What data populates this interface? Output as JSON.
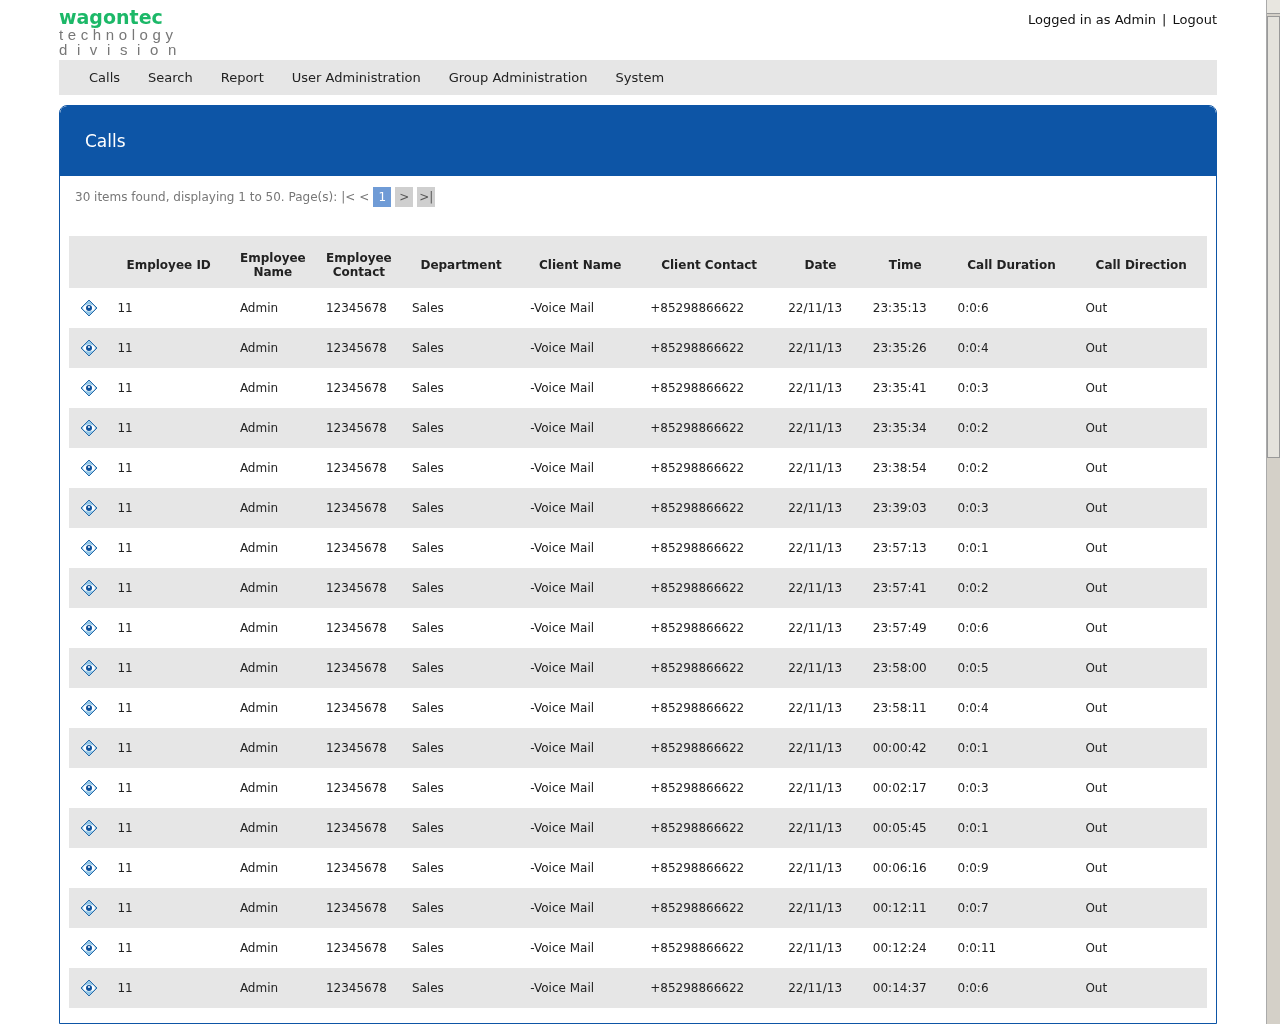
{
  "logo": {
    "brand": "wagontec",
    "line1": "technology",
    "line2": "division"
  },
  "user_bar": {
    "status": "Logged in as Admin",
    "separator": "|",
    "logout": "Logout"
  },
  "nav": [
    "Calls",
    "Search",
    "Report",
    "User Administration",
    "Group Administration",
    "System"
  ],
  "panel": {
    "title": "Calls",
    "pager": {
      "summary": "30 items found, displaying 1 to 50. Page(s):",
      "first": "|<",
      "prev": "<",
      "pages": [
        {
          "label": "1",
          "selected": true
        }
      ],
      "next": ">",
      "last": ">|"
    },
    "table": {
      "columns": [
        "",
        "Employee ID",
        "Employee Name",
        "Employee Contact",
        "Department",
        "Client Name",
        "Client Contact",
        "Date",
        "Time",
        "Call Duration",
        "Call Direction"
      ],
      "rows": [
        [
          "",
          "11",
          "Admin",
          "12345678",
          "Sales",
          "-Voice Mail",
          "+85298866622",
          "22/11/13",
          "23:35:13",
          "0:0:6",
          "Out"
        ],
        [
          "",
          "11",
          "Admin",
          "12345678",
          "Sales",
          "-Voice Mail",
          "+85298866622",
          "22/11/13",
          "23:35:26",
          "0:0:4",
          "Out"
        ],
        [
          "",
          "11",
          "Admin",
          "12345678",
          "Sales",
          "-Voice Mail",
          "+85298866622",
          "22/11/13",
          "23:35:41",
          "0:0:3",
          "Out"
        ],
        [
          "",
          "11",
          "Admin",
          "12345678",
          "Sales",
          "-Voice Mail",
          "+85298866622",
          "22/11/13",
          "23:35:34",
          "0:0:2",
          "Out"
        ],
        [
          "",
          "11",
          "Admin",
          "12345678",
          "Sales",
          "-Voice Mail",
          "+85298866622",
          "22/11/13",
          "23:38:54",
          "0:0:2",
          "Out"
        ],
        [
          "",
          "11",
          "Admin",
          "12345678",
          "Sales",
          "-Voice Mail",
          "+85298866622",
          "22/11/13",
          "23:39:03",
          "0:0:3",
          "Out"
        ],
        [
          "",
          "11",
          "Admin",
          "12345678",
          "Sales",
          "-Voice Mail",
          "+85298866622",
          "22/11/13",
          "23:57:13",
          "0:0:1",
          "Out"
        ],
        [
          "",
          "11",
          "Admin",
          "12345678",
          "Sales",
          "-Voice Mail",
          "+85298866622",
          "22/11/13",
          "23:57:41",
          "0:0:2",
          "Out"
        ],
        [
          "",
          "11",
          "Admin",
          "12345678",
          "Sales",
          "-Voice Mail",
          "+85298866622",
          "22/11/13",
          "23:57:49",
          "0:0:6",
          "Out"
        ],
        [
          "",
          "11",
          "Admin",
          "12345678",
          "Sales",
          "-Voice Mail",
          "+85298866622",
          "22/11/13",
          "23:58:00",
          "0:0:5",
          "Out"
        ],
        [
          "",
          "11",
          "Admin",
          "12345678",
          "Sales",
          "-Voice Mail",
          "+85298866622",
          "22/11/13",
          "23:58:11",
          "0:0:4",
          "Out"
        ],
        [
          "",
          "11",
          "Admin",
          "12345678",
          "Sales",
          "-Voice Mail",
          "+85298866622",
          "22/11/13",
          "00:00:42",
          "0:0:1",
          "Out"
        ],
        [
          "",
          "11",
          "Admin",
          "12345678",
          "Sales",
          "-Voice Mail",
          "+85298866622",
          "22/11/13",
          "00:02:17",
          "0:0:3",
          "Out"
        ],
        [
          "",
          "11",
          "Admin",
          "12345678",
          "Sales",
          "-Voice Mail",
          "+85298866622",
          "22/11/13",
          "00:05:45",
          "0:0:1",
          "Out"
        ],
        [
          "",
          "11",
          "Admin",
          "12345678",
          "Sales",
          "-Voice Mail",
          "+85298866622",
          "22/11/13",
          "00:06:16",
          "0:0:9",
          "Out"
        ],
        [
          "",
          "11",
          "Admin",
          "12345678",
          "Sales",
          "-Voice Mail",
          "+85298866622",
          "22/11/13",
          "00:12:11",
          "0:0:7",
          "Out"
        ],
        [
          "",
          "11",
          "Admin",
          "12345678",
          "Sales",
          "-Voice Mail",
          "+85298866622",
          "22/11/13",
          "00:12:24",
          "0:0:11",
          "Out"
        ],
        [
          "",
          "11",
          "Admin",
          "12345678",
          "Sales",
          "-Voice Mail",
          "+85298866622",
          "22/11/13",
          "00:14:37",
          "0:0:6",
          "Out"
        ]
      ]
    }
  }
}
